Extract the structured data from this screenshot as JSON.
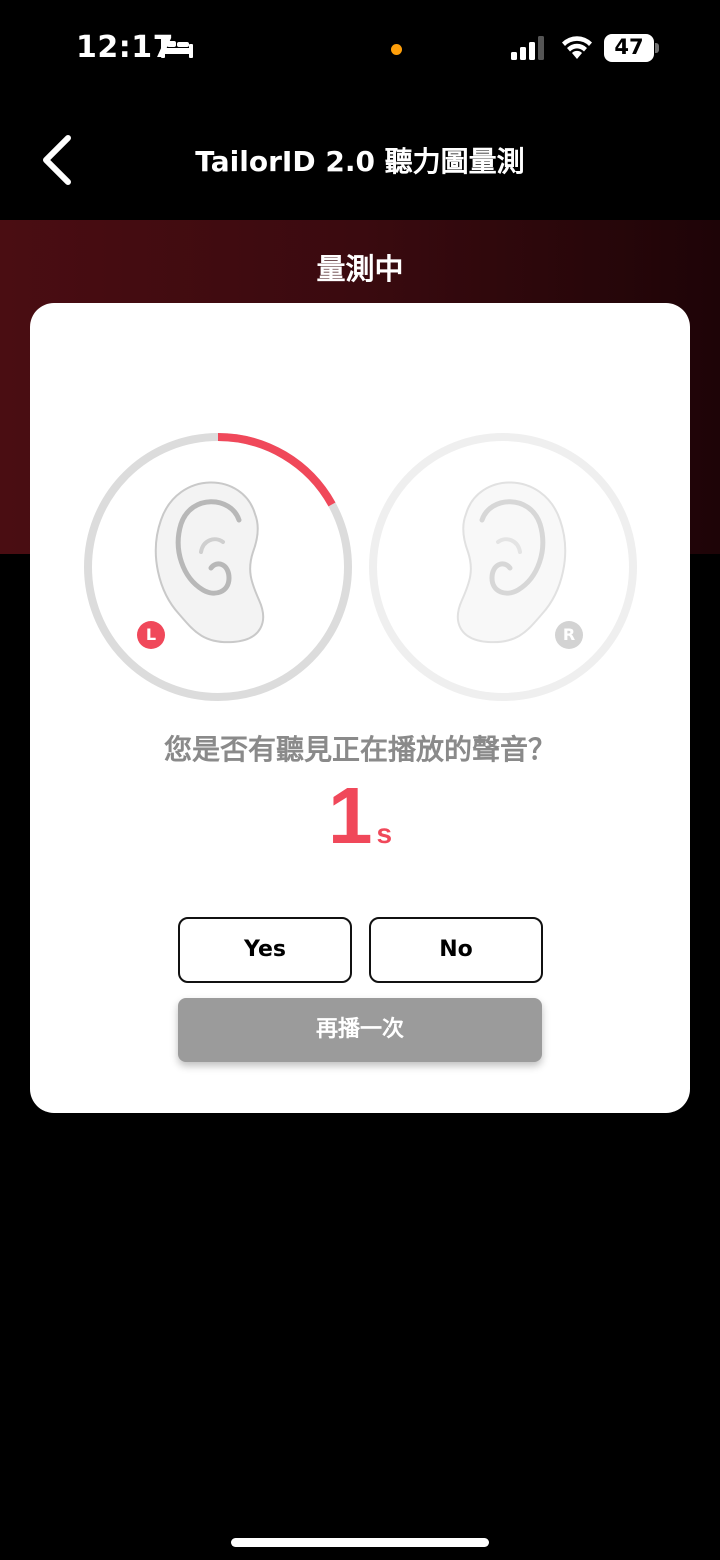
{
  "status_bar": {
    "time": "12:17",
    "battery_level": "47",
    "icons": [
      "bed-icon",
      "signal-icon",
      "wifi-icon",
      "battery-icon"
    ],
    "recording_dot_color": "#ff9f0a"
  },
  "nav": {
    "back_icon": "chevron-left-icon",
    "title": "TailorID 2.0 聽力圖量測"
  },
  "header": {
    "status": "量測中"
  },
  "test": {
    "left_ear": {
      "badge": "L",
      "progress": 0.17,
      "active": true
    },
    "right_ear": {
      "badge": "R",
      "progress": 0,
      "active": false
    },
    "question": "您是否有聽見正在播放的聲音？",
    "countdown_value": "1",
    "countdown_unit": "s",
    "yes_label": "Yes",
    "no_label": "No",
    "replay_label": "再播一次"
  },
  "colors": {
    "accent": "#f0485a",
    "band_dark": "#3a0a0f",
    "replay_button": "#9b9b9b"
  }
}
